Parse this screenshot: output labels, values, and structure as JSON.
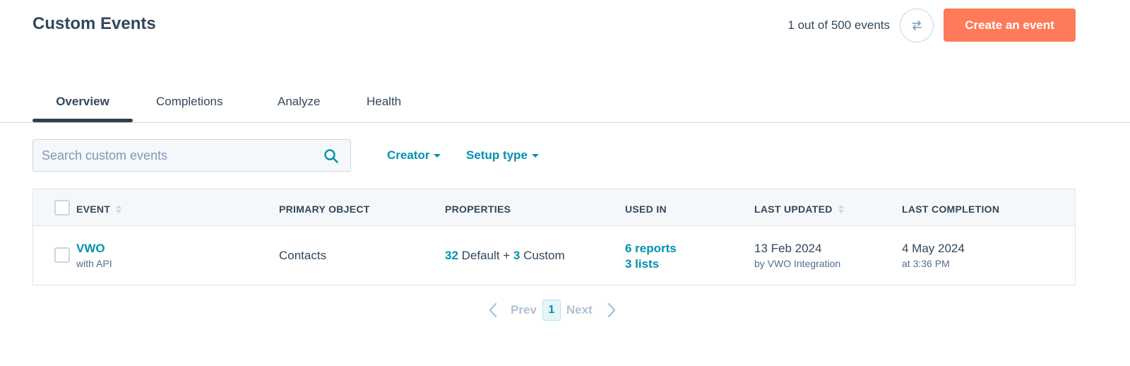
{
  "header": {
    "title": "Custom Events",
    "event_count": "1 out of 500 events",
    "create_button": "Create an event"
  },
  "tabs": [
    {
      "label": "Overview",
      "active": true
    },
    {
      "label": "Completions",
      "active": false
    },
    {
      "label": "Analyze",
      "active": false
    },
    {
      "label": "Health",
      "active": false
    }
  ],
  "search": {
    "placeholder": "Search custom events",
    "value": ""
  },
  "filters": {
    "creator": "Creator",
    "setup_type": "Setup type"
  },
  "table": {
    "columns": {
      "event": "EVENT",
      "primary_object": "PRIMARY OBJECT",
      "properties": "PROPERTIES",
      "used_in": "USED IN",
      "last_updated": "LAST UPDATED",
      "last_completion": "LAST COMPLETION"
    },
    "rows": [
      {
        "event_name": "VWO",
        "event_sub": "with API",
        "primary_object": "Contacts",
        "properties_default_count": "32",
        "properties_default_label": " Default + ",
        "properties_custom_count": "3",
        "properties_custom_label": " Custom",
        "used_in_reports": "6 reports",
        "used_in_lists": "3 lists",
        "last_updated_date": "13 Feb 2024",
        "last_updated_by": "by VWO Integration",
        "last_completion_date": "4 May 2024",
        "last_completion_time": "at 3:36 PM"
      }
    ]
  },
  "pagination": {
    "prev": "Prev",
    "current_page": "1",
    "next": "Next"
  },
  "colors": {
    "accent": "#ff7a59",
    "link": "#0091ae",
    "text": "#33475b"
  }
}
